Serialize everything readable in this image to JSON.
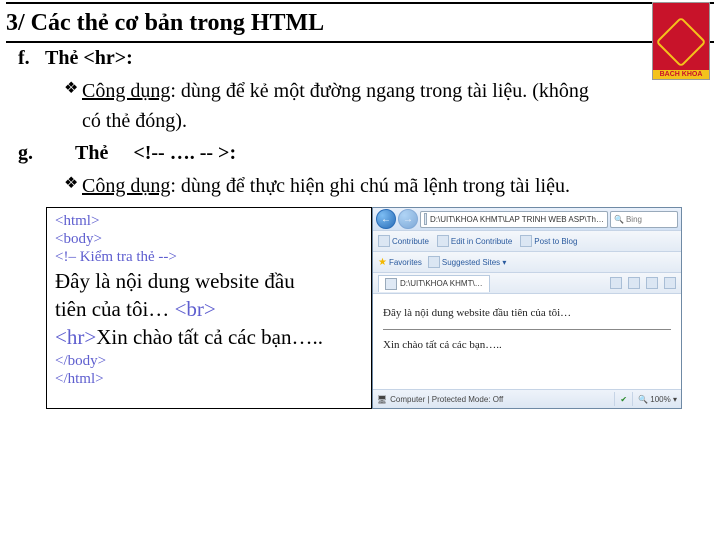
{
  "title": "3/ Các thẻ cơ bản trong HTML",
  "logo_text": "BACH KHOA",
  "section_f": {
    "letter": "f.",
    "heading": "Thẻ  <hr>:",
    "bullet_label": "Công dụng",
    "bullet_text": ": dùng để kẻ một đường ngang trong tài liệu. (không",
    "bullet_cont": "có thẻ đóng)."
  },
  "section_g": {
    "letter": "g.",
    "heading_pre": "Thẻ",
    "heading_tag": "<!-- …. -- >:",
    "bullet_label": "Công dụng",
    "bullet_text": ": dùng để thực hiện ghi chú mã lệnh trong tài liệu."
  },
  "code": {
    "l1": "<html>",
    "l2": "<body>",
    "l3": "<!– Kiểm tra thẻ -->",
    "big1a": "Đây là nội dung website đầu",
    "big1b": "tiên của tôi… ",
    "br": "<br>",
    "hr": "<hr>",
    "big2": "Xin chào tất cả các bạn…..",
    "l4": "</body>",
    "l5": "</html>"
  },
  "browser": {
    "address": "D:\\UIT\\KHOA KHMT\\LAP TRINH WEB ASP\\Th…",
    "search": "Bing",
    "toolbar": {
      "contrib": "Contribute",
      "edit": "Edit in Contribute",
      "post": "Post to Blog"
    },
    "fav_label": "Favorites",
    "sugg": "Suggested Sites ▾",
    "tab": "D:\\UIT\\KHOA KHMT\\…",
    "page_l1": "Đây là nội dung website đầu tiên của tôi…",
    "page_l2": "Xin chào tất cả các bạn…..",
    "status": {
      "comp": "Computer | Protected Mode: Off",
      "zoom": "100%"
    }
  }
}
